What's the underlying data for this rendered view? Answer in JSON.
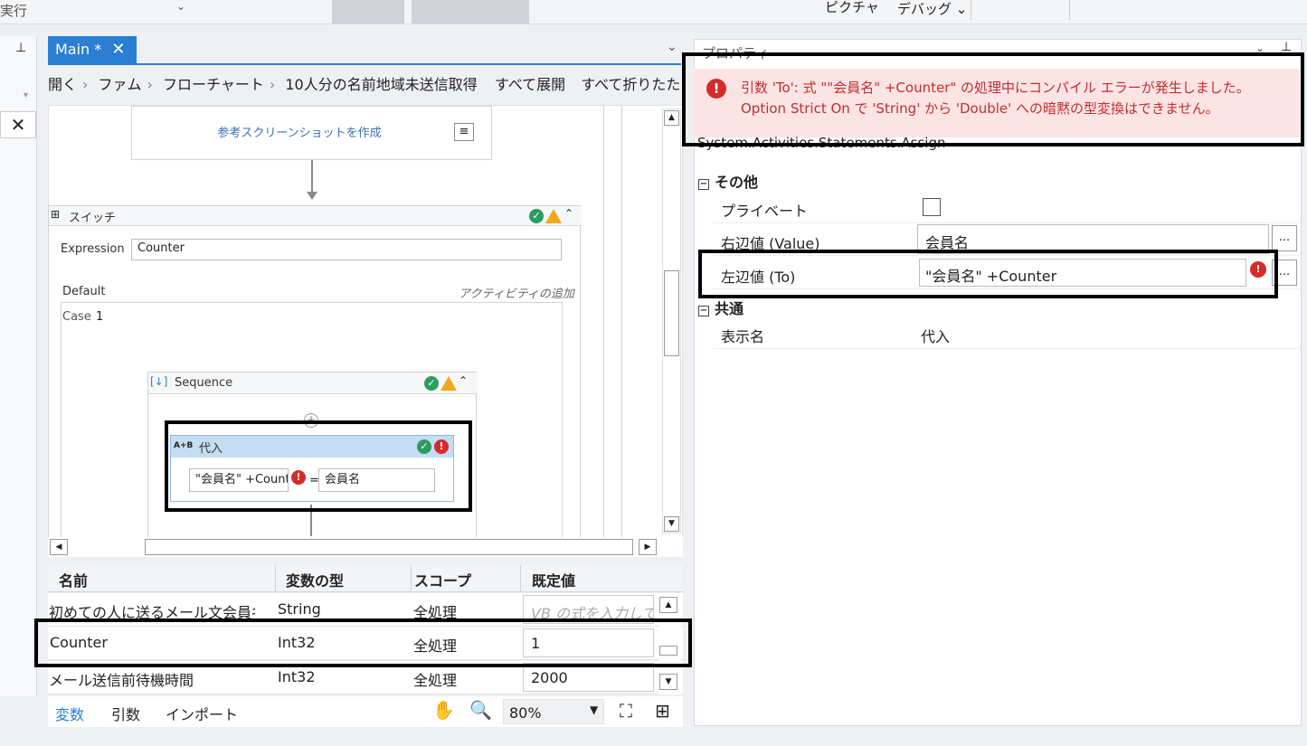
{
  "topbar": {
    "run_label": "実行",
    "picture_label": "ピクチャ",
    "debug_label": "デバッグ ⌄"
  },
  "tab": {
    "label": "Main *",
    "close": "✕"
  },
  "breadcrumb": {
    "items": [
      "開く",
      "ファム",
      "フローチャート",
      "10人分の名前地域未送信取得"
    ],
    "expand_all": "すべて展開",
    "collapse_all": "すべて折りたたみ"
  },
  "canvas": {
    "screenshot_activity": "参考スクリーンショットを作成",
    "switch": {
      "title": "スイッチ",
      "expression_label": "Expression",
      "expression_value": "Counter",
      "default_label": "Default",
      "add_activity": "アクティビティの追加",
      "case_label": "Case",
      "case_value": "1"
    },
    "sequence": {
      "title": "Sequence"
    },
    "assign": {
      "title": "代入",
      "icon_text": "A+B",
      "to_value": "\"会員名\" +Counter",
      "equals": "=",
      "value": "会員名"
    }
  },
  "variables": {
    "headers": {
      "name": "名前",
      "type": "変数の型",
      "scope": "スコープ",
      "default": "既定値"
    },
    "rows": [
      {
        "name": "初めての人に送るメール文会員名",
        "type": "String",
        "scope": "全処理",
        "default": "VB の式を入力して"
      },
      {
        "name": "Counter",
        "type": "Int32",
        "scope": "全処理",
        "default": "1"
      },
      {
        "name": "メール送信前待機時間",
        "type": "Int32",
        "scope": "全処理",
        "default": "2000"
      }
    ]
  },
  "bottombar": {
    "variables": "変数",
    "arguments": "引数",
    "imports": "インポート",
    "zoom": "80%"
  },
  "properties": {
    "title": "プロパティ",
    "error_line1": "引数 'To': 式 \"\"会員名\" +Counter\" の処理中にコンパイル エラーが発生しました。",
    "error_line2": "Option Strict On で 'String' から 'Double' への暗黙の型変換はできません。",
    "class_name": "System.Activities.Statements.Assign",
    "section_other": "その他",
    "private_label": "プライベート",
    "value_label": "右辺値 (Value)",
    "value_value": "会員名",
    "to_label": "左辺値 (To)",
    "to_value": "\"会員名\" +Counter",
    "section_common": "共通",
    "display_name_label": "表示名",
    "display_name_value": "代入",
    "ellipsis": "..."
  },
  "colors": {
    "accent": "#2a7fd4",
    "error": "#d42b2b",
    "error_bg": "#fde4e4"
  }
}
